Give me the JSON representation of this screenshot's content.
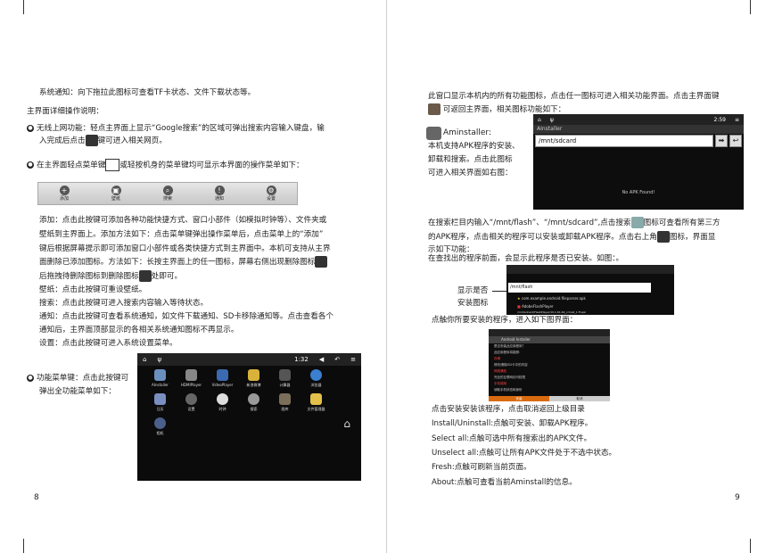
{
  "left": {
    "line1": "系统通知：向下拖拉此图标可查看TF卡状态、文件下载状态等。",
    "heading": "主界面详细操作说明：",
    "b1_line1": "无线上网功能：轻点主界面上显示“Google搜索”的区域可弹出搜索内容输入键盘，输",
    "b1_line2a": "入完成后点击",
    "b1_line2b": "键可进入相关网页。",
    "b2_a": "在主界面轻点菜单键",
    "b2_b": "或轻按机身的菜单键均可显示本界面的操作菜单如下：",
    "toolbar": [
      "添加",
      "壁纸",
      "搜索",
      "通知",
      "设置"
    ],
    "para": [
      "添加：点击此按键可添加各种功能快捷方式、窗口小部件（如模拟时钟等）、文件夹或",
      "壁纸到主界面上。添加方法如下：点击菜单键弹出操作菜单后，点击菜单上的“添加”",
      "键后根据屏幕提示即可添加窗口小部件或各类快捷方式到主界面中。本机可支持从主界",
      "面删除已添加图标。方法如下：长按主界面上的任一图标，屏幕右侧出现删除图标",
      "后拖拽待删除图标到删除图标",
      "处即可。",
      "壁纸：点击此按键可重设壁纸。",
      "搜索：点击此按键可进入搜索内容输入等待状态。",
      "通知：点击此按键可查看系统通知，如文件下载通知、SD卡移除通知等。点击查看各个",
      "通知后，主界面顶部显示的各相关系统通知图标不再显示。",
      "设置：点击此按键可进入系统设置菜单。"
    ],
    "b3_1": "功能菜单键：点击此按键可",
    "b3_2": "弹出全功能菜单如下：",
    "drawer_time": "1:32",
    "apps": [
      "AInstaller",
      "HDMIPlayer",
      "VideoPlayer",
      "新浪微博",
      "计算器",
      "浏览器",
      "日历",
      "设置",
      "时钟",
      "搜索",
      "图库",
      "文件管理器",
      "相机"
    ],
    "page_number": "8"
  },
  "right": {
    "p1": "此窗口显示本机内的所有功能图标，点击任一图标可进入相关功能界面。点击主界面键",
    "p2": "可返回主界面，相关图标功能如下：",
    "aminstaller_title": "Aminstaller:",
    "aminstaller_desc": [
      "本机支持APK程序的安装、",
      "卸载和搜索。点击此图标",
      "可进入相关界面如右图："
    ],
    "shot1_time": "2:59",
    "shot1_title": "AInstaller",
    "shot1_path": "/mnt/sdcard",
    "shot1_msg": "No APK Found!",
    "search_para": [
      "在搜索栏目内输入“/mnt/flash”、“/mnt/sdcard”,点击搜索",
      "图标可查看所有第三方",
      "的APK程序，点击相关的程序可以安装或卸载APK程序。点击右上角",
      "图标，界面显",
      "示如下功能：",
      "在查找出的程序前面，会显示此程序是否已安装。如图：。"
    ],
    "label_install": [
      "显示是否",
      "安装图标"
    ],
    "shot2_path": "/mnt/flash",
    "shot2_rows": [
      "com.example.android.fileparser.apk",
      "AdobeFlashPlayer",
      "/mnt/sdcard/FlashPlayer/10.1.61.64_crmall_1.ff.apk"
    ],
    "click_install": "点触你所要安装的程序，进入如下图界面：",
    "shot3_head": "Android Installer",
    "shot3_lines": [
      "是否安装此应用程序？",
      "此应用程序将能够：",
      "存储",
      "修改/删除SD卡中的内容",
      "网络通信",
      "完全的互联网访问权限",
      "手机调用",
      "读取手机状态和身份"
    ],
    "shot3_btns": [
      "安装",
      "取消"
    ],
    "list": [
      "点击安装安装该程序，点击取消返回上级目录",
      "Install/Uninstall:点触可安装、卸载APK程序。",
      "Select all:点触可选中所有搜索出的APK文件。",
      "Unselect all:点触可让所有APK文件处于不选中状态。",
      "Fresh:点触可刷新当前页面。",
      "About:点触可查看当前Aminstall的信息。"
    ],
    "page_number": "9"
  }
}
